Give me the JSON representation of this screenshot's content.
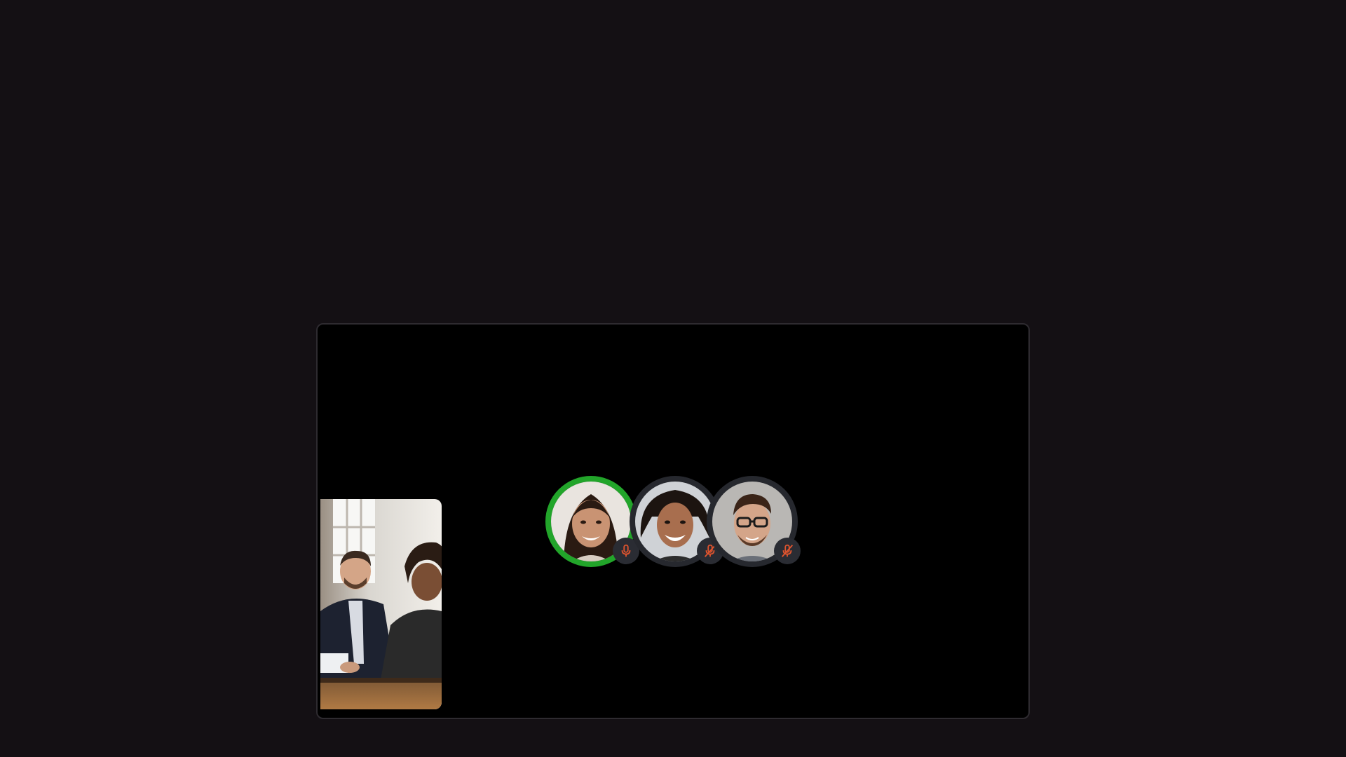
{
  "call": {
    "self_view": {
      "icon": "video-feed"
    },
    "participants": [
      {
        "speaking": true,
        "mic": "on",
        "mic_icon": "mic-icon",
        "color": "#22a52a"
      },
      {
        "speaking": false,
        "mic": "off",
        "mic_icon": "mic-muted-icon",
        "color": "#e0542e"
      },
      {
        "speaking": false,
        "mic": "off",
        "mic_icon": "mic-muted-icon",
        "color": "#e0542e"
      }
    ]
  },
  "colors": {
    "background": "#141014",
    "stage": "#000000",
    "speaking_ring": "#22a52a",
    "muted": "#e0542e"
  }
}
